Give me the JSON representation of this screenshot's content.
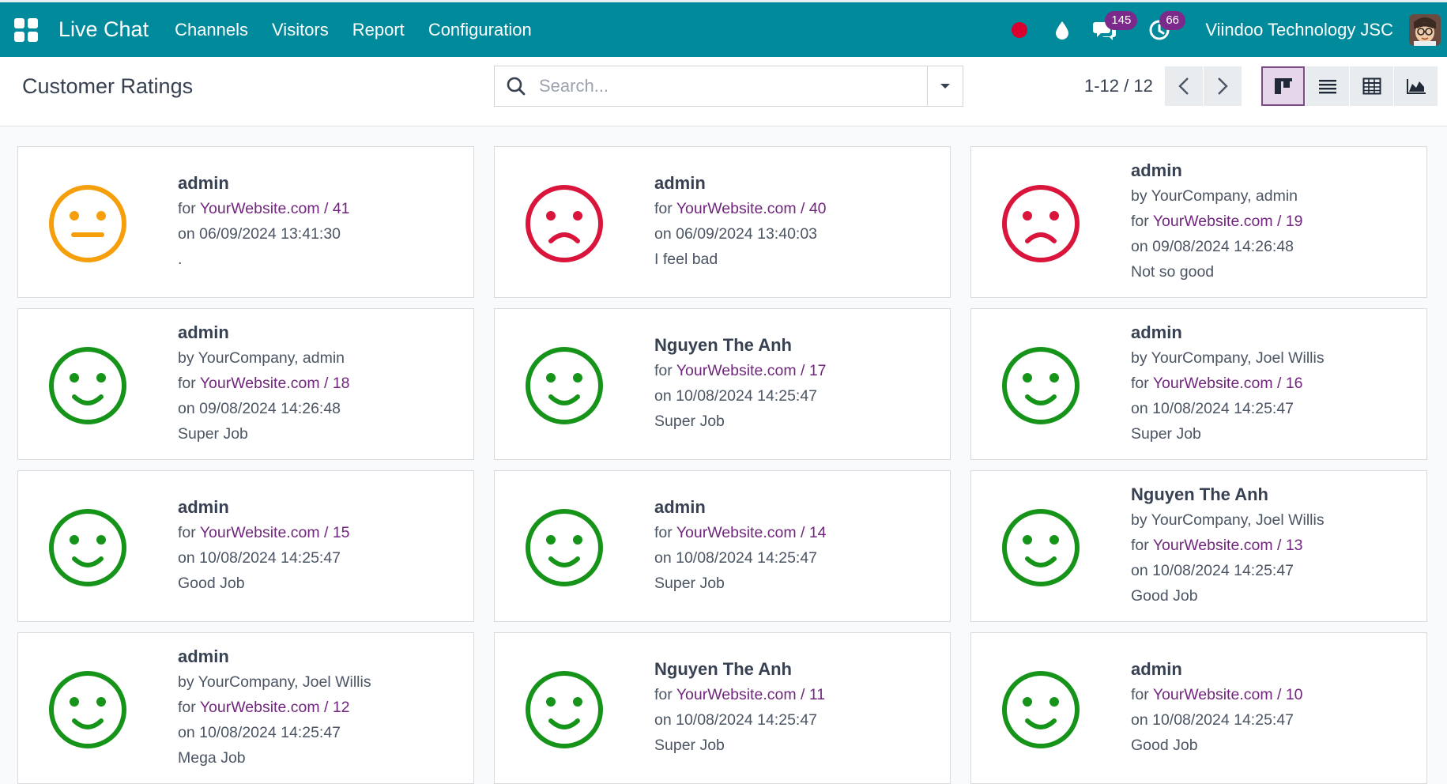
{
  "nav": {
    "brand": "Live Chat",
    "menu": [
      "Channels",
      "Visitors",
      "Report",
      "Configuration"
    ],
    "messages_badge": "145",
    "activities_badge": "66",
    "company": "Viindoo Technology JSC",
    "colors": {
      "navbar": "#018a9b",
      "badge": "#7b2a8c",
      "recording_dot": "#d9002f"
    }
  },
  "control": {
    "title": "Customer Ratings",
    "search_placeholder": "Search...",
    "pager": "1-12 / 12",
    "views": [
      "kanban",
      "list",
      "pivot",
      "graph"
    ],
    "active_view": "kanban"
  },
  "colors": {
    "happy": "#16941a",
    "neutral": "#f59f0c",
    "unhappy": "#d9153b",
    "link": "#71267d"
  },
  "ratings": [
    {
      "mood": "neutral",
      "name": "admin",
      "by": "",
      "for_prefix": "for ",
      "for_link": "YourWebsite.com / 41",
      "date": "on 06/09/2024 13:41:30",
      "feedback": "."
    },
    {
      "mood": "unhappy",
      "name": "admin",
      "by": "",
      "for_prefix": "for ",
      "for_link": "YourWebsite.com / 40",
      "date": "on 06/09/2024 13:40:03",
      "feedback": "I feel bad"
    },
    {
      "mood": "unhappy",
      "name": "admin",
      "by": "by YourCompany, admin",
      "for_prefix": "for ",
      "for_link": "YourWebsite.com / 19",
      "date": "on 09/08/2024 14:26:48",
      "feedback": "Not so good"
    },
    {
      "mood": "happy",
      "name": "admin",
      "by": "by YourCompany, admin",
      "for_prefix": "for ",
      "for_link": "YourWebsite.com / 18",
      "date": "on 09/08/2024 14:26:48",
      "feedback": "Super Job"
    },
    {
      "mood": "happy",
      "name": "Nguyen The Anh",
      "by": "",
      "for_prefix": "for ",
      "for_link": "YourWebsite.com / 17",
      "date": "on 10/08/2024 14:25:47",
      "feedback": "Super Job"
    },
    {
      "mood": "happy",
      "name": "admin",
      "by": "by YourCompany, Joel Willis",
      "for_prefix": "for ",
      "for_link": "YourWebsite.com / 16",
      "date": "on 10/08/2024 14:25:47",
      "feedback": "Super Job"
    },
    {
      "mood": "happy",
      "name": "admin",
      "by": "",
      "for_prefix": "for ",
      "for_link": "YourWebsite.com / 15",
      "date": "on 10/08/2024 14:25:47",
      "feedback": "Good Job"
    },
    {
      "mood": "happy",
      "name": "admin",
      "by": "",
      "for_prefix": "for ",
      "for_link": "YourWebsite.com / 14",
      "date": "on 10/08/2024 14:25:47",
      "feedback": "Super Job"
    },
    {
      "mood": "happy",
      "name": "Nguyen The Anh",
      "by": "by YourCompany, Joel Willis",
      "for_prefix": "for ",
      "for_link": "YourWebsite.com / 13",
      "date": "on 10/08/2024 14:25:47",
      "feedback": "Good Job"
    },
    {
      "mood": "happy",
      "name": "admin",
      "by": "by YourCompany, Joel Willis",
      "for_prefix": "for ",
      "for_link": "YourWebsite.com / 12",
      "date": "on 10/08/2024 14:25:47",
      "feedback": "Mega Job"
    },
    {
      "mood": "happy",
      "name": "Nguyen The Anh",
      "by": "",
      "for_prefix": "for ",
      "for_link": "YourWebsite.com / 11",
      "date": "on 10/08/2024 14:25:47",
      "feedback": "Super Job"
    },
    {
      "mood": "happy",
      "name": "admin",
      "by": "",
      "for_prefix": "for ",
      "for_link": "YourWebsite.com / 10",
      "date": "on 10/08/2024 14:25:47",
      "feedback": "Good Job"
    }
  ]
}
